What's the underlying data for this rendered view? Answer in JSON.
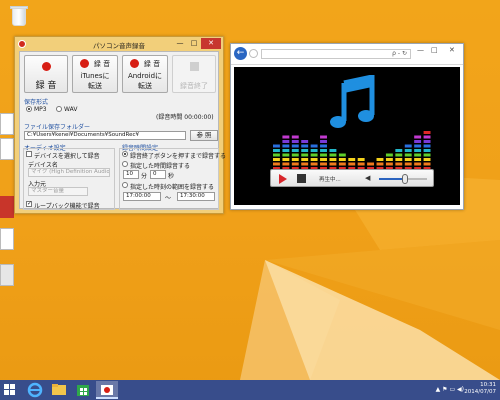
{
  "recorder": {
    "title": "パソコン音声録音",
    "buttons": {
      "record": "録 音",
      "itunes_top": "録 音",
      "itunes_mid": "iTunesに",
      "itunes_bottom": "転送",
      "android_top": "録 音",
      "android_mid": "Androidに",
      "android_bottom": "転送",
      "stop": "録音終了"
    },
    "format": {
      "label": "保存形式",
      "mp3": "MP3",
      "wav": "WAV",
      "selected": "MP3"
    },
    "record_time": "(録音時間 00:00:00)",
    "folder": {
      "label": "ファイル保存フォルダー",
      "path": "C:¥Users¥kenei¥Documents¥SoundRec¥",
      "ref_button": "参 照"
    },
    "audio": {
      "label": "オーディオ設定",
      "choose_device": "デバイスを選択して録音",
      "device_name_label": "デバイス名",
      "device_name_value": "マイク (High Definition Audio...",
      "input_label": "入力元",
      "input_value": "マスター音量",
      "loopback": "ループバック機能で録音"
    },
    "time": {
      "label": "録音時間設定",
      "until_stop": "録音終了ボタンを押すまで録音する",
      "fixed_time": "指定した時間録音する",
      "minutes_value": "10",
      "minutes_unit": "分",
      "seconds_value": "0",
      "seconds_unit": "秒",
      "range": "指定した時刻の範囲を録音する",
      "start_time": "17:00:00",
      "dash": "〜",
      "end_time": "17:30:00"
    },
    "window_buttons": {
      "minimize": "—",
      "maximize": "□",
      "close": "✕"
    }
  },
  "media": {
    "address": "",
    "address_icons": "ρ - ↻",
    "window_buttons": {
      "minimize": "—",
      "maximize": "□",
      "close": "✕"
    },
    "player_status": "再生中...",
    "volume": 0.55
  },
  "taskbar": {
    "time": "10:31",
    "date": "2014/07/07",
    "tray_icons": "▲ ⚑ ▭ ◀)"
  },
  "colors": {
    "desktop": "#f0a019",
    "record_red": "#d71e14",
    "label_blue": "#1f4fa0",
    "taskbar": "#2c4a96",
    "note_blue": "#1f8fe0"
  }
}
